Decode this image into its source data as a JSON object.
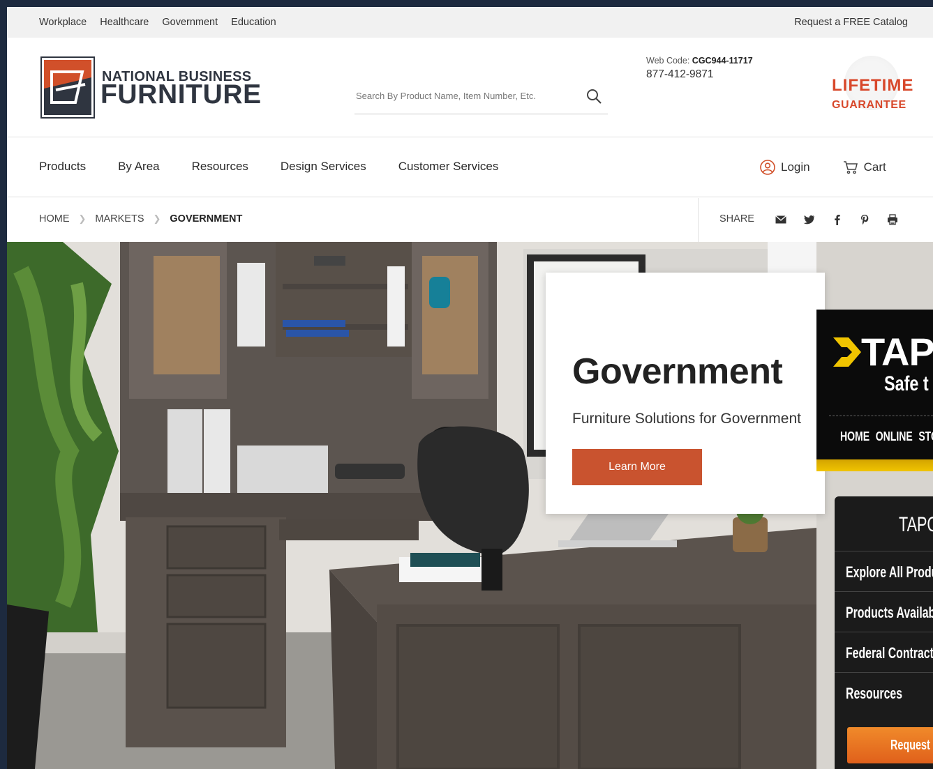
{
  "utility_bar": {
    "links": [
      "Workplace",
      "Healthcare",
      "Government",
      "Education"
    ],
    "catalog": "Request a FREE Catalog"
  },
  "header": {
    "logo_line1": "NATIONAL BUSINESS",
    "logo_line2": "FURNITURE",
    "search_placeholder": "Search By Product Name, Item Number, Etc.",
    "webcode_label": "Web Code:",
    "webcode_value": "CGC944-11717",
    "phone": "877-412-9871",
    "guarantee_line1": "LIFETIME",
    "guarantee_line2": "GUARANTEE"
  },
  "nav": {
    "items": [
      "Products",
      "By Area",
      "Resources",
      "Design Services",
      "Customer Services"
    ],
    "login": "Login",
    "cart": "Cart"
  },
  "breadcrumb": {
    "items": [
      "HOME",
      "MARKETS",
      "GOVERNMENT"
    ],
    "share_label": "SHARE"
  },
  "hero": {
    "title": "Government",
    "subtitle": "Furniture Solutions for Government",
    "cta": "Learn More"
  },
  "tapco": {
    "brand": "TAP",
    "tagline": "Safe t",
    "nav": "HOME  ONLINE STO",
    "menu_title": "TAPC",
    "menu_items": [
      "Explore All Product",
      "Products Available",
      "Federal Contracts",
      "Resources"
    ],
    "request": "Request M"
  },
  "colors": {
    "accent": "#c9532f",
    "guarantee": "#d8482b",
    "tapco_yellow": "#f0c400",
    "tapco_orange": "#e0601b"
  }
}
